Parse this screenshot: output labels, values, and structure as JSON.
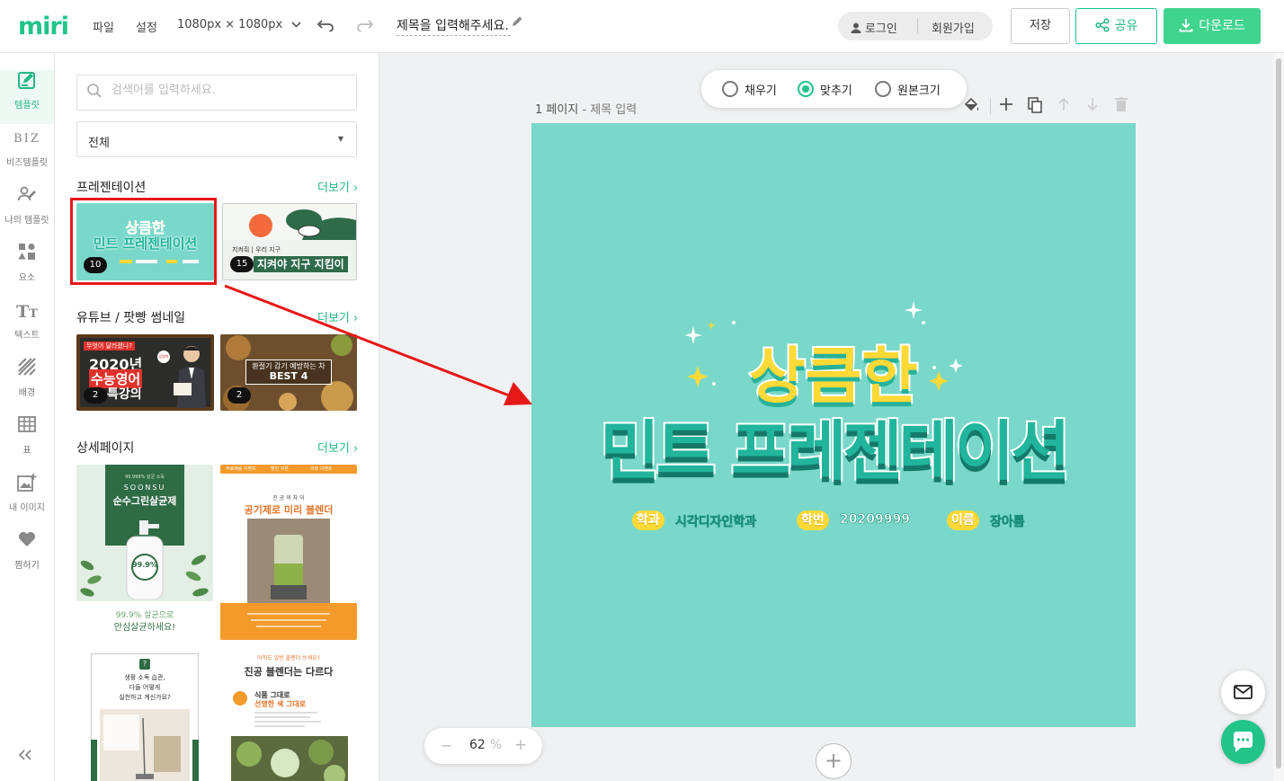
{
  "header": {
    "logo": "miri",
    "menu": [
      "파일",
      "설정"
    ],
    "size_label": "1080px × 1080px",
    "doc_title": "제목을 입력해주세요.",
    "auth": {
      "login": "로그인",
      "signup": "회원가입"
    },
    "save_label": "저장",
    "share_label": "공유",
    "download_label": "다운로드"
  },
  "rail": {
    "items": [
      {
        "label": "템플릿",
        "icon": "template-edit-icon",
        "active": true
      },
      {
        "label": "비즈템플릿",
        "icon": "biz-icon",
        "active": false
      },
      {
        "label": "나의 템플릿",
        "icon": "my-template-icon",
        "active": false
      },
      {
        "label": "요소",
        "icon": "elements-icon",
        "active": false
      },
      {
        "label": "텍스트",
        "icon": "text-icon",
        "active": false
      },
      {
        "label": "배경",
        "icon": "background-icon",
        "active": false
      },
      {
        "label": "표",
        "icon": "table-icon",
        "active": false
      },
      {
        "label": "내 이미지",
        "icon": "my-image-icon",
        "active": false
      },
      {
        "label": "찜하기",
        "icon": "heart-icon",
        "active": false
      }
    ],
    "biz_glyph": "BIZ"
  },
  "panel": {
    "search_placeholder": "검색어를 입력하세요.",
    "category": "전체",
    "more_label": "더보기",
    "sections": [
      {
        "title": "프레젠테이션",
        "thumbs": [
          {
            "badge": "10",
            "line1": "상큼한",
            "line2": "민트 프레젠테이션"
          },
          {
            "badge": "15",
            "line1": "지켜야 지구 지킴이",
            "line2": "지켜줘 | 우리 지구"
          }
        ]
      },
      {
        "title": "유튜브 / 팟빵 썸네일",
        "thumbs": [
          {
            "badge": "2",
            "line1": "2020년",
            "line2": "수능영어",
            "line3": "특강의",
            "tag": "무엇이 달라졌나?",
            "stamp": "김영어"
          },
          {
            "badge": "2",
            "line1": "환절기 감기 예방하는 차",
            "line2": "BEST 4"
          }
        ]
      },
      {
        "title": "상세페이지",
        "thumbs": [
          {
            "brand": "SOONSU",
            "kicker": "99.999% 살균 소독",
            "product": "순수그린살균제",
            "label": "99.9%",
            "caption1": "99.9% 살균으로",
            "caption2": "안심살균하세요!"
          },
          {
            "kicker": "진 공 의 차 이",
            "product": "공기제로 미리 블렌더",
            "tabs": [
              "무료배송 이벤트",
              "할인 쿠폰",
              "리뷰 이벤트"
            ]
          },
          {
            "mark": "?",
            "line1": "생활 소독 습관,",
            "line2": "다들 어떻게",
            "line3": "실천하고 계신가요?"
          },
          {
            "kicker": "아직도 일반 블렌더 쓰세요?",
            "product": "진공 블렌더는 다르다",
            "feature1": "식품 그대로",
            "feature2": "선명한 색 그대로"
          }
        ]
      }
    ]
  },
  "canvas": {
    "fit_options": [
      {
        "label": "채우기",
        "selected": false
      },
      {
        "label": "맞추기",
        "selected": true
      },
      {
        "label": "원본크기",
        "selected": false
      }
    ],
    "page_label": "1 페이지",
    "page_sub": "제목 입력",
    "slide": {
      "title_top": "상큼한",
      "title_main": "민트 프레젠테이션",
      "fields": [
        {
          "key": "학과",
          "value": "시각디자인학과"
        },
        {
          "key": "학번",
          "value": "20209999"
        },
        {
          "key": "이름",
          "value": "장아름"
        }
      ]
    },
    "zoom_value": "62",
    "zoom_unit": "%"
  },
  "colors": {
    "brand": "#22c48a",
    "mint_bg": "#79d8c9",
    "slide_yellow": "#ffd936",
    "slide_teal": "#1fb49b",
    "annotation_red": "#e61919"
  }
}
